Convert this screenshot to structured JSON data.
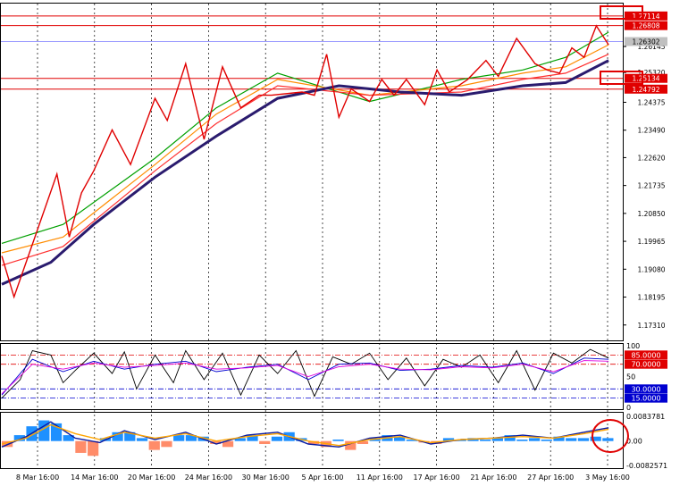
{
  "chart_data": [
    {
      "type": "line",
      "panel": "price",
      "price_axis_ticks": [
        "1.26145",
        "1.25320",
        "1.24375",
        "1.23490",
        "1.22620",
        "1.21735",
        "1.20850",
        "1.19965",
        "1.19080",
        "1.18195",
        "1.17310"
      ],
      "y_range": [
        1.1685,
        1.2745
      ],
      "horizontal_levels": [
        {
          "value": "1.27114",
          "color": "#e00000"
        },
        {
          "value": "1.26808",
          "color": "#e00000"
        },
        {
          "value": "1.25134",
          "color": "#e00000"
        },
        {
          "value": "1.24792",
          "color": "#e00000"
        }
      ],
      "bid_line": {
        "value": "1.26302",
        "color": "#7a7aff"
      },
      "x_range": [
        0,
        100
      ],
      "zigzag": {
        "color": "#e00000",
        "x": [
          0,
          2,
          9,
          11,
          13,
          15,
          18,
          21,
          25,
          27,
          30,
          33,
          36,
          39,
          42,
          44,
          49,
          51,
          53,
          55,
          57,
          60,
          62,
          64,
          66,
          69,
          71,
          73,
          76,
          79,
          81,
          84,
          87,
          89,
          91,
          93,
          95,
          97,
          99
        ],
        "y": [
          1.195,
          1.182,
          1.221,
          1.201,
          1.215,
          1.222,
          1.235,
          1.224,
          1.245,
          1.238,
          1.256,
          1.232,
          1.255,
          1.242,
          1.246,
          1.246,
          1.247,
          1.246,
          1.259,
          1.239,
          1.248,
          1.244,
          1.251,
          1.246,
          1.251,
          1.243,
          1.254,
          1.247,
          1.251,
          1.257,
          1.252,
          1.264,
          1.256,
          1.254,
          1.253,
          1.261,
          1.258,
          1.268,
          1.262
        ]
      },
      "ma_band": [
        {
          "color": "#00a000",
          "x": [
            0,
            10,
            25,
            35,
            45,
            60,
            75,
            85,
            92,
            99
          ],
          "y": [
            1.199,
            1.205,
            1.226,
            1.242,
            1.253,
            1.244,
            1.251,
            1.254,
            1.258,
            1.266
          ]
        },
        {
          "color": "#ff8c00",
          "x": [
            0,
            10,
            25,
            35,
            45,
            60,
            75,
            85,
            92,
            99
          ],
          "y": [
            1.196,
            1.201,
            1.224,
            1.24,
            1.251,
            1.246,
            1.249,
            1.253,
            1.255,
            1.262
          ]
        },
        {
          "color": "#ff3030",
          "x": [
            0,
            10,
            25,
            35,
            45,
            60,
            75,
            85,
            92,
            99
          ],
          "y": [
            1.192,
            1.198,
            1.222,
            1.237,
            1.249,
            1.246,
            1.247,
            1.251,
            1.253,
            1.259
          ]
        },
        {
          "color": "#2a1b6e",
          "x": [
            0,
            8,
            15,
            25,
            35,
            45,
            55,
            65,
            75,
            85,
            92,
            99
          ],
          "y": [
            1.186,
            1.193,
            1.205,
            1.22,
            1.233,
            1.245,
            1.249,
            1.247,
            1.246,
            1.249,
            1.25,
            1.257
          ]
        }
      ]
    },
    {
      "type": "line",
      "panel": "oscillator",
      "y_range": [
        0,
        100
      ],
      "y_ticks": [
        "100",
        "50",
        "0"
      ],
      "levels": [
        {
          "value": "85.0000",
          "color": "#e00000"
        },
        {
          "value": "70.0000",
          "color": "#e00000"
        },
        {
          "value": "30.0000",
          "color": "#0000d0"
        },
        {
          "value": "15.0000",
          "color": "#0000d0"
        }
      ],
      "x_range": [
        0,
        100
      ],
      "series": [
        {
          "color": "#000000",
          "x": [
            0,
            3,
            5,
            8,
            10,
            12,
            15,
            18,
            20,
            22,
            25,
            28,
            30,
            33,
            36,
            39,
            42,
            45,
            48,
            51,
            54,
            57,
            60,
            63,
            66,
            69,
            72,
            75,
            78,
            81,
            84,
            87,
            90,
            93,
            96,
            99
          ],
          "y": [
            15,
            45,
            92,
            85,
            40,
            60,
            88,
            55,
            90,
            30,
            85,
            40,
            92,
            45,
            88,
            20,
            85,
            55,
            92,
            18,
            82,
            70,
            88,
            45,
            80,
            35,
            78,
            65,
            85,
            40,
            92,
            28,
            88,
            72,
            94,
            80
          ]
        },
        {
          "color": "#0000d0",
          "x": [
            0,
            5,
            10,
            15,
            20,
            25,
            30,
            35,
            40,
            45,
            50,
            55,
            60,
            65,
            70,
            75,
            80,
            85,
            90,
            95,
            99
          ],
          "y": [
            20,
            78,
            58,
            75,
            62,
            70,
            75,
            58,
            65,
            70,
            45,
            70,
            72,
            60,
            62,
            68,
            65,
            72,
            55,
            80,
            78
          ]
        },
        {
          "color": "#e000e0",
          "x": [
            0,
            5,
            10,
            15,
            20,
            25,
            30,
            35,
            40,
            45,
            50,
            55,
            60,
            65,
            70,
            75,
            80,
            85,
            90,
            95,
            99
          ],
          "y": [
            22,
            70,
            62,
            72,
            65,
            68,
            72,
            62,
            64,
            68,
            50,
            66,
            70,
            62,
            61,
            66,
            64,
            70,
            58,
            76,
            75
          ]
        }
      ]
    },
    {
      "type": "bar",
      "panel": "macd",
      "y_ticks": [
        "0.0083781",
        "0.00",
        "-0.0082571"
      ],
      "y_range": [
        -0.0082571,
        0.0083781
      ],
      "histogram": {
        "positive_color": "#1e90ff",
        "negative_color": "#ff8c69",
        "x": [
          0,
          2,
          4,
          6,
          8,
          10,
          12,
          14,
          16,
          18,
          20,
          22,
          24,
          26,
          28,
          30,
          32,
          34,
          36,
          38,
          40,
          42,
          44,
          46,
          48,
          50,
          52,
          54,
          56,
          58,
          60,
          62,
          64,
          66,
          68,
          70,
          72,
          74,
          76,
          78,
          80,
          82,
          84,
          86,
          88,
          90,
          92,
          94,
          96,
          98
        ],
        "values": [
          -0.002,
          0.002,
          0.005,
          0.007,
          0.006,
          0.002,
          -0.004,
          -0.005,
          0.001,
          0.003,
          0.003,
          0.001,
          -0.003,
          -0.002,
          0.002,
          0.002,
          0.0015,
          -0.001,
          -0.002,
          0.001,
          0.002,
          -0.001,
          0.0015,
          0.003,
          0.001,
          -0.001,
          -0.002,
          0.0005,
          -0.003,
          -0.001,
          0.001,
          0.002,
          0.0015,
          0.0005,
          -0.0005,
          -0.001,
          0.001,
          0.0005,
          0.001,
          0.0005,
          0.001,
          0.002,
          0.0005,
          0.001,
          0.0005,
          0.0015,
          0.001,
          0.001,
          0.0015,
          0.001
        ]
      },
      "series": [
        {
          "color": "#0a1aa0",
          "x": [
            0,
            4,
            8,
            12,
            16,
            20,
            25,
            30,
            35,
            40,
            45,
            50,
            55,
            60,
            65,
            70,
            75,
            80,
            85,
            90,
            95,
            99
          ],
          "y": [
            -0.002,
            0.0015,
            0.0065,
            0.001,
            -0.0005,
            0.0035,
            0.0005,
            0.003,
            -0.001,
            0.002,
            0.003,
            -0.001,
            -0.002,
            0.001,
            0.002,
            -0.001,
            0.0005,
            0.001,
            0.002,
            0.001,
            0.003,
            0.0045
          ]
        },
        {
          "color": "#ffa500",
          "x": [
            0,
            4,
            8,
            12,
            16,
            20,
            25,
            30,
            35,
            40,
            45,
            50,
            55,
            60,
            65,
            70,
            75,
            80,
            85,
            90,
            95,
            99
          ],
          "y": [
            -0.001,
            0.001,
            0.0055,
            0.0025,
            0.0005,
            0.003,
            0.001,
            0.0025,
            0.0,
            0.0015,
            0.0025,
            0.0,
            -0.0015,
            0.0005,
            0.0015,
            -0.0005,
            0.0005,
            0.001,
            0.0015,
            0.001,
            0.0025,
            0.004
          ]
        }
      ]
    }
  ],
  "x_axis_labels": [
    "8 Mar 16:00",
    "14 Mar 16:00",
    "20 Mar 16:00",
    "24 Mar 16:00",
    "30 Mar 16:00",
    "5 Apr 16:00",
    "11 Apr 16:00",
    "17 Apr 16:00",
    "21 Apr 16:00",
    "27 Apr 16:00",
    "3 May 16:00"
  ]
}
